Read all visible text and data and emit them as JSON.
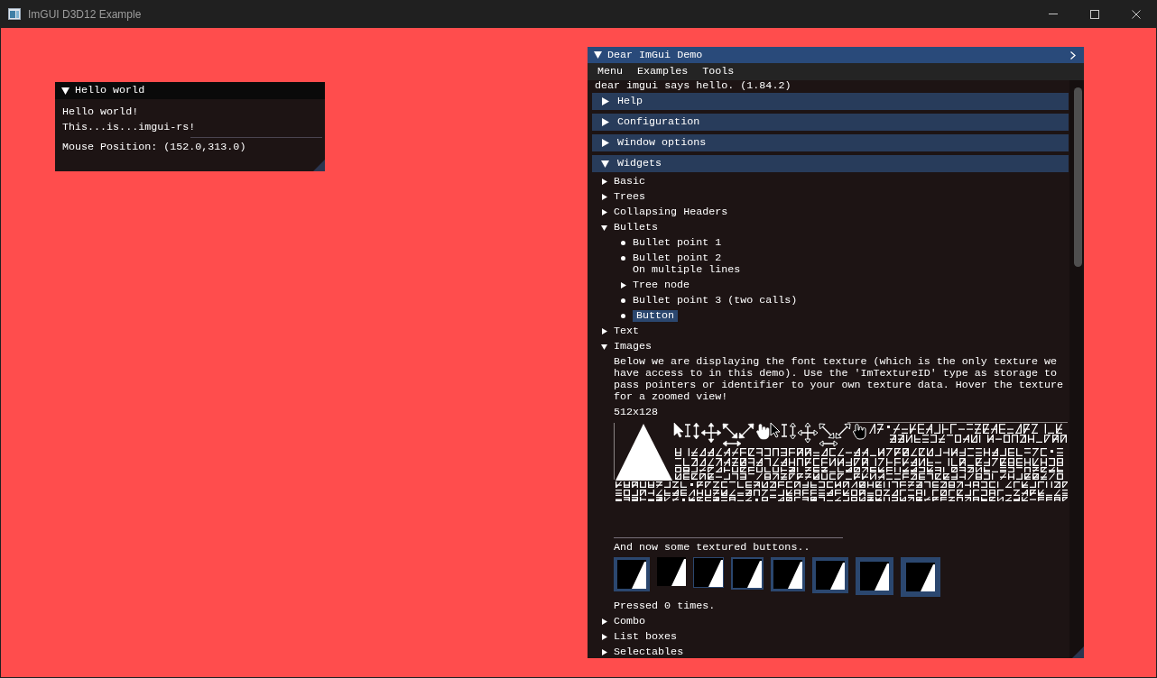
{
  "app_window": {
    "title": "ImGUI D3D12 Example"
  },
  "hello_window": {
    "title": "Hello world",
    "expanded": true,
    "focused": false,
    "items": [
      {
        "kind": "text",
        "text": "Hello world!"
      },
      {
        "kind": "text",
        "text": "This...is...imgui-rs!"
      },
      {
        "kind": "separator"
      },
      {
        "kind": "text",
        "text": "Mouse Position: (152.0,313.0)"
      }
    ]
  },
  "demo_window": {
    "title": "Dear ImGui Demo",
    "expanded": true,
    "focused": true,
    "menu": [
      {
        "label": "Menu"
      },
      {
        "label": "Examples"
      },
      {
        "label": "Tools"
      }
    ],
    "content": [
      {
        "kind": "text",
        "text": "dear imgui says hello. (1.84.2)"
      },
      {
        "kind": "header",
        "label": "Help",
        "expanded": false
      },
      {
        "kind": "header",
        "label": "Configuration",
        "expanded": false
      },
      {
        "kind": "header",
        "label": "Window options",
        "expanded": false
      },
      {
        "kind": "header",
        "label": "Widgets",
        "expanded": true,
        "children": [
          {
            "kind": "tree",
            "label": "Basic",
            "expanded": false
          },
          {
            "kind": "tree",
            "label": "Trees",
            "expanded": false
          },
          {
            "kind": "tree",
            "label": "Collapsing Headers",
            "expanded": false
          },
          {
            "kind": "tree",
            "label": "Bullets",
            "expanded": true,
            "children": [
              {
                "kind": "bullet",
                "text": "Bullet point 1"
              },
              {
                "kind": "bullet",
                "text": "Bullet point 2\nOn multiple lines"
              },
              {
                "kind": "tree",
                "label": "Tree node",
                "expanded": false
              },
              {
                "kind": "bullet",
                "text": "Bullet point 3 (two calls)"
              },
              {
                "kind": "bullet_button",
                "label": "Button"
              }
            ]
          },
          {
            "kind": "tree",
            "label": "Text",
            "expanded": false
          },
          {
            "kind": "tree",
            "label": "Images",
            "expanded": true,
            "children": [
              {
                "kind": "text",
                "text": "Below we are displaying the font texture (which is the only texture we have access to in this demo). Use the 'ImTextureID' type as storage to pass pointers or identifier to your own texture data. Hover the texture for a zoomed view!"
              },
              {
                "kind": "text",
                "text": "512x128"
              },
              {
                "kind": "image"
              },
              {
                "kind": "text",
                "text": "And now some textured buttons.."
              },
              {
                "kind": "image_buttons"
              },
              {
                "kind": "text",
                "text": "Pressed 0 times."
              }
            ]
          },
          {
            "kind": "tree",
            "label": "Combo",
            "expanded": false
          },
          {
            "kind": "tree",
            "label": "List boxes",
            "expanded": false
          },
          {
            "kind": "tree",
            "label": "Selectables",
            "expanded": false
          }
        ]
      }
    ]
  }
}
